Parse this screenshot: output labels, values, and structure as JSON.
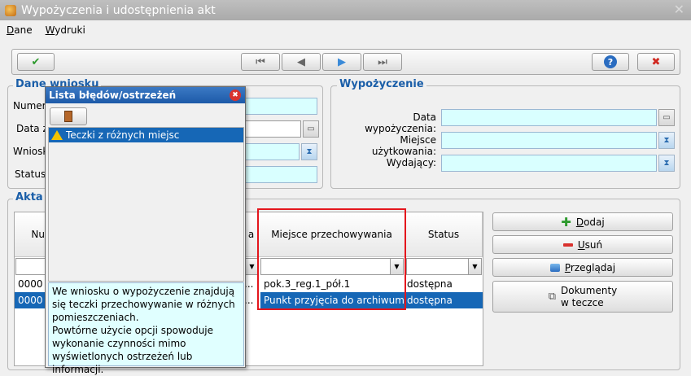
{
  "window": {
    "title": "Wypożyczenia i udostępnienia akt"
  },
  "menu": {
    "items": [
      "Dane",
      "Wydruki"
    ]
  },
  "toolbar": {
    "confirm": "✔",
    "first": "⏮",
    "prev": "◀",
    "next": "▶",
    "last": "⏭",
    "help": "?",
    "cancel": "✖"
  },
  "dane_wniosku": {
    "title": "Dane wniosku",
    "labels": [
      "Numer",
      "Data z",
      "Wniosk",
      "Status"
    ]
  },
  "wypozyczenie": {
    "title": "Wypożyczenie",
    "data_label": "Data wypożyczenia:",
    "miejsce_label": "Miejsce użytkowania:",
    "wydajacy_label": "Wydający:"
  },
  "akta": {
    "title": "Akta",
    "columns": [
      "Nu",
      "a",
      "Miejsce przechowywania",
      "Status"
    ],
    "rows": [
      {
        "num": "0000",
        "dots": "...",
        "miejsce": "pok.3_reg.1_pół.1",
        "status": "dostępna"
      },
      {
        "num": "0000",
        "dots": "...",
        "miejsce": "Punkt przyjęcia do archiwum",
        "status": "dostępna"
      }
    ]
  },
  "actions": {
    "dodaj": "Dodaj",
    "usun": "Usuń",
    "przegladaj": "Przeglądaj",
    "dokumenty_line1": "Dokumenty",
    "dokumenty_line2": "w teczce"
  },
  "popup": {
    "title": "Lista błędów/ostrzeżeń",
    "item": "Teczki z różnych miejsc",
    "message": "We wniosku o wypożyczenie znajdują się teczki przechowywanie w różnych pomieszczeniach.\nPowtórne użycie opcji spowoduje wykonanie czynności mimo wyświetlonych ostrzeżeń lub informacji."
  },
  "colors": {
    "accent": "#1667b6",
    "title_blue": "#1a5ea8",
    "input_cyan": "#d9ffff",
    "highlight": "#e4161d"
  }
}
